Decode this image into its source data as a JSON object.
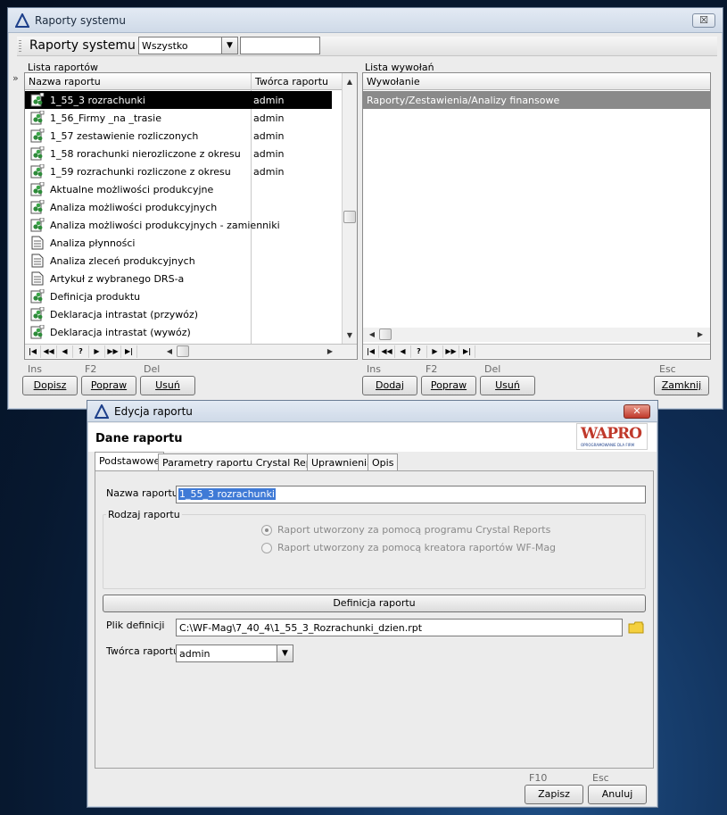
{
  "main_window": {
    "title": "Raporty systemu",
    "close_label": "☒",
    "toolbar": {
      "title": "Raporty systemu",
      "filter_value": "Wszystko",
      "search_value": ""
    },
    "expander": "»",
    "left_panel": {
      "label": "Lista raportów",
      "columns": [
        "Nazwa raportu",
        "Twórca raportu"
      ],
      "rows": [
        {
          "name": "1_55_3 rozrachunki",
          "author": "admin",
          "icon": "crystal-report-icon",
          "selected": true
        },
        {
          "name": "1_56_Firmy _na _trasie",
          "author": "admin",
          "icon": "crystal-report-icon"
        },
        {
          "name": "1_57 zestawienie rozliczonych",
          "author": "admin",
          "icon": "crystal-report-icon"
        },
        {
          "name": "1_58 rorachunki nierozliczone z okresu",
          "author": "admin",
          "icon": "crystal-report-icon"
        },
        {
          "name": "1_59 rozrachunki rozliczone z okresu",
          "author": "admin",
          "icon": "crystal-report-icon"
        },
        {
          "name": "Aktualne możliwości produkcyjne",
          "author": "",
          "icon": "crystal-report-icon"
        },
        {
          "name": "Analiza możliwości produkcyjnych",
          "author": "",
          "icon": "crystal-report-icon"
        },
        {
          "name": "Analiza możliwości produkcyjnych - zamienniki",
          "author": "",
          "icon": "crystal-report-icon"
        },
        {
          "name": "Analiza płynności",
          "author": "",
          "icon": "document-report-icon"
        },
        {
          "name": "Analiza zleceń produkcyjnych",
          "author": "",
          "icon": "document-report-icon"
        },
        {
          "name": "Artykuł z wybranego DRS-a",
          "author": "",
          "icon": "document-report-icon"
        },
        {
          "name": "Definicja produktu",
          "author": "",
          "icon": "crystal-report-icon"
        },
        {
          "name": "Deklaracja intrastat (przywóz)",
          "author": "",
          "icon": "crystal-report-icon"
        },
        {
          "name": "Deklaracja intrastat (wywóz)",
          "author": "",
          "icon": "crystal-report-icon"
        }
      ],
      "nav": [
        "|◀",
        "◀◀",
        "◀",
        "?",
        "▶",
        "▶▶",
        "▶|"
      ],
      "keys": {
        "ins": "Ins",
        "f2": "F2",
        "del": "Del"
      },
      "buttons": {
        "add": "Dopisz",
        "edit": "Popraw",
        "delete": "Usuń"
      }
    },
    "right_panel": {
      "label": "Lista wywołań",
      "columns": [
        "Wywołanie"
      ],
      "rows": [
        {
          "name": "Raporty/Zestawienia/Analizy finansowe",
          "selected": true
        }
      ],
      "nav": [
        "|◀",
        "◀◀",
        "◀",
        "?",
        "▶",
        "▶▶",
        "▶|"
      ],
      "keys": {
        "ins": "Ins",
        "f2": "F2",
        "del": "Del",
        "esc": "Esc"
      },
      "buttons": {
        "add": "Dodaj",
        "edit": "Popraw",
        "delete": "Usuń",
        "close": "Zamknij"
      }
    }
  },
  "edit_dialog": {
    "title": "Edycja raportu",
    "close_label": "✕",
    "header": "Dane raportu",
    "logo": {
      "text": "WAPRO",
      "tagline": "OPROGRAMOWANIE DLA FIRM"
    },
    "tabs": [
      "Podstawowe",
      "Parametry raportu Crystal Reports",
      "Uprawnienia",
      "Opis"
    ],
    "fields": {
      "name_label": "Nazwa raportu",
      "name_value": "1_55_3 rozrachunki",
      "type_label": "Rodzaj raportu",
      "type_options": [
        {
          "label": "Raport utworzony za pomocą programu Crystal Reports",
          "checked": true
        },
        {
          "label": "Raport utworzony za pomocą kreatora raportów WF-Mag",
          "checked": false
        }
      ],
      "definition_button": "Definicja raportu",
      "file_label": "Plik definicji",
      "file_value": "C:\\WF-Mag\\7_40_4\\1_55_3_Rozrachunki_dzien.rpt",
      "author_label": "Twórca raportu",
      "author_value": "admin"
    },
    "keys": {
      "f10": "F10",
      "esc": "Esc"
    },
    "buttons": {
      "save": "Zapisz",
      "cancel": "Anuluj"
    }
  },
  "colors": {
    "selection": "#000000",
    "accent_red": "#c0392b",
    "title_blue": "#1b2a3d"
  }
}
